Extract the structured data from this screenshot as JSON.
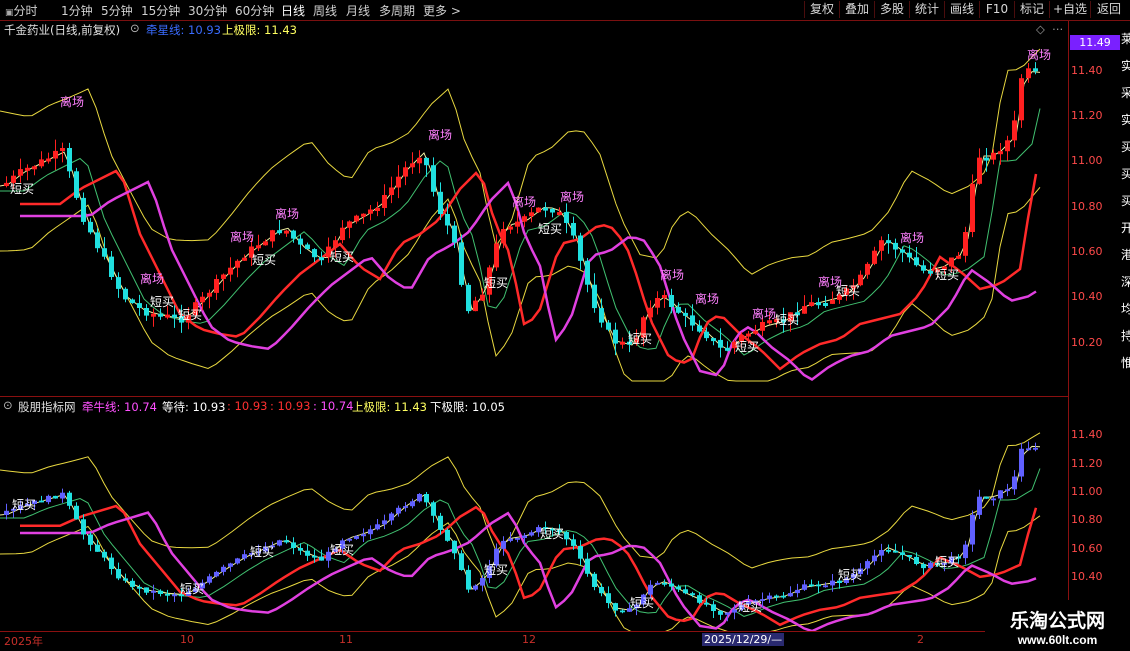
{
  "toolbar": {
    "periods": [
      "分时",
      "1分钟",
      "5分钟",
      "15分钟",
      "30分钟",
      "60分钟",
      "日线",
      "周线",
      "月线",
      "多周期",
      "更多 >"
    ],
    "active_period": "日线",
    "right_buttons": [
      "复权",
      "叠加",
      "多股",
      "统计",
      "画线",
      "F10",
      "标记",
      "+自选",
      "返回"
    ]
  },
  "main_panel": {
    "title": "千金药业(日线,前复权)",
    "ind1_label": "牵星线: 10.93",
    "ind2_label": "上极限: 11.43",
    "current_price_tag": "11.49",
    "y_ticks": [
      "11.40",
      "11.20",
      "11.00",
      "10.80",
      "10.60",
      "10.40",
      "10.20"
    ],
    "labels_leave": "离场",
    "labels_buy": "短买"
  },
  "sub_panel": {
    "title": "股朋指标网",
    "values": [
      "牵牛线: 10.74",
      "等待: 10.93",
      ": 10.93",
      ": 10.93",
      ": 10.74",
      "上极限: 11.43",
      "下极限: 10.05"
    ],
    "y_ticks": [
      "11.40",
      "11.20",
      "11.00",
      "10.80",
      "10.60",
      "10.40"
    ]
  },
  "date_axis": {
    "labels": [
      "2025年",
      "10",
      "11",
      "12",
      "2025/12/29/—",
      "2"
    ]
  },
  "watermark": {
    "title": "乐淘公式网",
    "url": "www.60lt.com"
  },
  "side_text": [
    "莱",
    "实",
    "采",
    "实",
    "买",
    "买",
    "买",
    "开",
    "港",
    "深",
    "均",
    "持",
    "惟"
  ],
  "colors": {
    "up": "#ff2020",
    "down": "#20e0e0",
    "ma_yellow": "#e8d840",
    "ma_red": "#ff2a2a",
    "ma_magenta": "#e040e0",
    "ma_green": "#40c070",
    "highlight_pink": "#ff80ff",
    "highlight_green": "#c8f040",
    "blue_bar": "#6060ff"
  }
}
